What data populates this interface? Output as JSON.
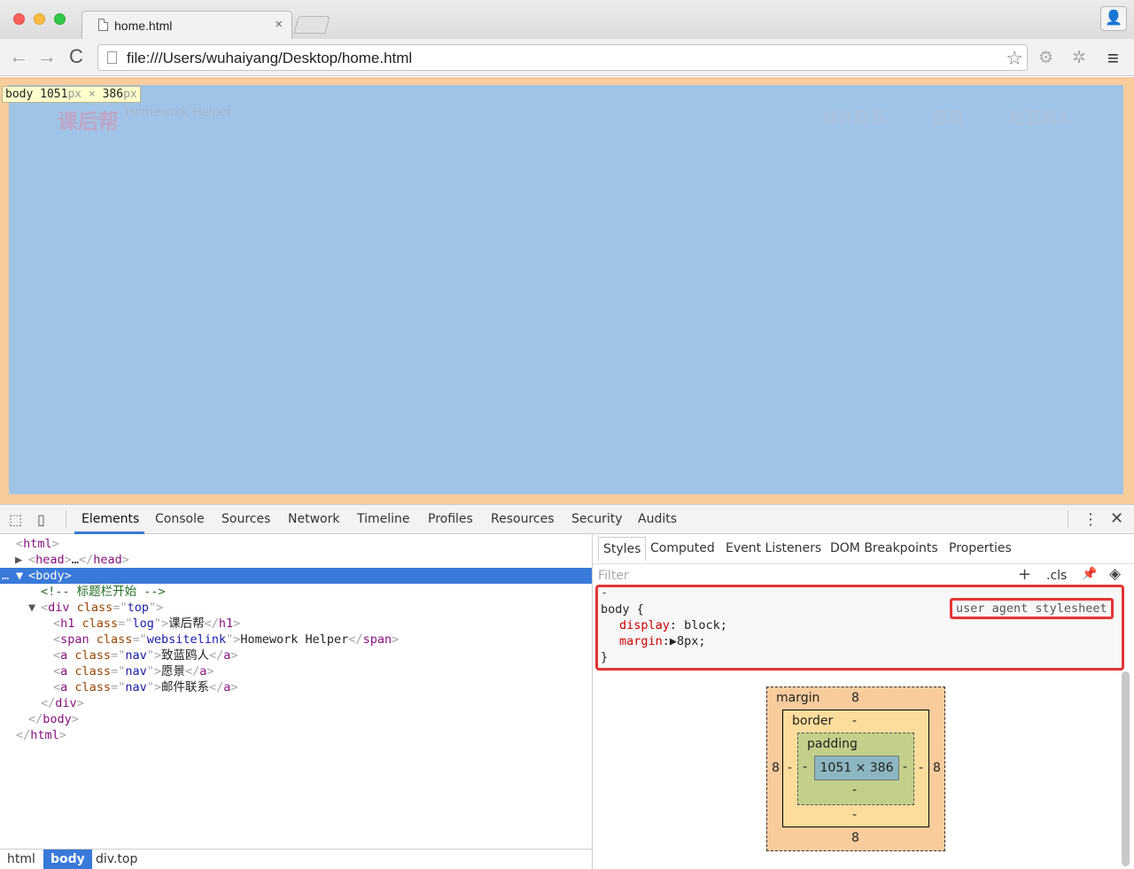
{
  "browser": {
    "tab_title": "home.html",
    "tab_close": "×",
    "url": "file:///Users/wuhaiyang/Desktop/home.html",
    "back_icon": "←",
    "forward_icon": "→",
    "reload_icon": "C",
    "star_icon": "☆",
    "menu_icon": "≡",
    "ext1_icon": "⚙",
    "ext2_icon": "✲",
    "profile_icon": "👤"
  },
  "page": {
    "hint_tag": "body",
    "hint_w": "1051",
    "hint_h": "386",
    "hint_unit": "px",
    "hint_times": "×",
    "logo": "课后帮",
    "website_link": "Homework Helper",
    "nav": [
      "邮件联系",
      "愿景",
      "致蓝鸥人"
    ],
    "body_color": "#a0c4e7",
    "margin_color": "#f9cc9d"
  },
  "devtools": {
    "tabs": [
      "Elements",
      "Console",
      "Sources",
      "Network",
      "Timeline",
      "Profiles",
      "Resources",
      "Security",
      "Audits"
    ],
    "more_icon": "⋮",
    "close_icon": "✕",
    "inspect_icon": "⬚",
    "device_icon": "▯",
    "tree": {
      "html_open": "html",
      "head": "head",
      "head_ellipsis": "…",
      "body": "body",
      "comment": "<!-- 标题栏开始 -->",
      "div": "div",
      "div_attr": "class",
      "div_val": "top",
      "h1": "h1",
      "h1_val": "log",
      "h1_text": "课后帮",
      "span": "span",
      "span_val": "websitelink",
      "span_text": "Homework Helper",
      "a": "a",
      "a_val": "nav",
      "a1_text": "致蓝鸥人",
      "a2_text": "愿景",
      "a3_text": "邮件联系",
      "dots": "…"
    },
    "breadcrumbs": [
      "html",
      "body",
      "div.top"
    ],
    "styles": {
      "sub_tabs": [
        "Styles",
        "Computed",
        "Event Listeners",
        "DOM Breakpoints",
        "Properties"
      ],
      "filter_placeholder": "Filter",
      "plus": "+",
      "cls": ".cls",
      "pin_icon": "📌",
      "diamond_icon": "◈",
      "dash": "-",
      "selector": "body {",
      "source": "user agent stylesheet",
      "prop1": "display",
      "val1": "block;",
      "prop2": "margin",
      "val2": "▶8px;",
      "close_brace": "}"
    },
    "box_model": {
      "margin_label": "margin",
      "margin_top": "8",
      "margin_bottom": "8",
      "margin_left": "8",
      "margin_right": "8",
      "border_label": "border",
      "border_top": "-",
      "border_bottom": "-",
      "border_left": "-",
      "border_right": "-",
      "padding_label": "padding",
      "padding_top": "-",
      "padding_bottom": "-",
      "padding_left": "-",
      "padding_right": "-",
      "content": "1051 × 386"
    }
  }
}
